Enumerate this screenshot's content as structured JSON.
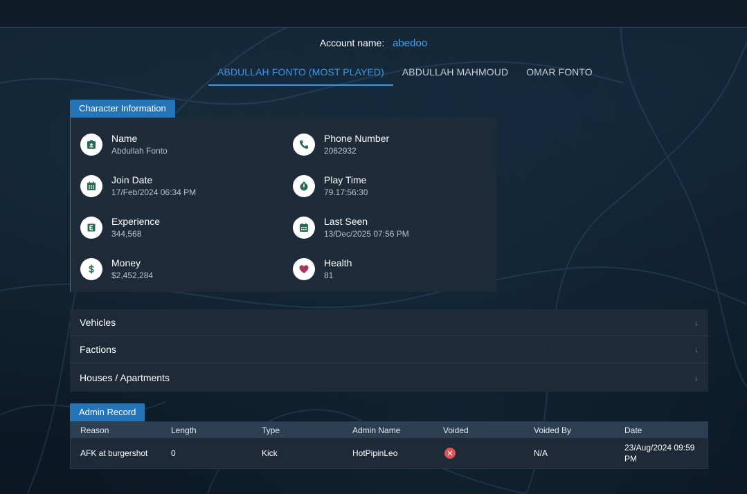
{
  "account": {
    "label": "Account name:",
    "value": "abedoo"
  },
  "tabs": [
    {
      "label": "ABDULLAH FONTO (MOST PLAYED)",
      "active": true
    },
    {
      "label": "ABDULLAH MAHMOUD",
      "active": false
    },
    {
      "label": "OMAR FONTO",
      "active": false
    }
  ],
  "character": {
    "title": "Character Information",
    "stats": [
      {
        "label": "Name",
        "value": "Abdullah Fonto",
        "icon": "id-badge-icon"
      },
      {
        "label": "Phone Number",
        "value": "2062932",
        "icon": "phone-icon"
      },
      {
        "label": "Join Date",
        "value": "17/Feb/2024 06:34 PM",
        "icon": "calendar-icon"
      },
      {
        "label": "Play Time",
        "value": "79.17:56:30",
        "icon": "stopwatch-icon"
      },
      {
        "label": "Experience",
        "value": "344,568",
        "icon": "experience-icon"
      },
      {
        "label": "Last Seen",
        "value": "13/Dec/2025 07:56 PM",
        "icon": "calendar-icon"
      },
      {
        "label": "Money",
        "value": "$2,452,284",
        "icon": "dollar-icon"
      },
      {
        "label": "Health",
        "value": "81",
        "icon": "heart-icon"
      }
    ]
  },
  "sections": [
    {
      "label": "Vehicles"
    },
    {
      "label": "Factions"
    },
    {
      "label": "Houses / Apartments"
    }
  ],
  "admin": {
    "title": "Admin Record",
    "columns": [
      "Reason",
      "Length",
      "Type",
      "Admin Name",
      "Voided",
      "Voided By",
      "Date"
    ],
    "rows": [
      {
        "reason": "AFK at burgershot",
        "length": "0",
        "type": "Kick",
        "admin": "HotPipinLeo",
        "voided": false,
        "voided_by": "N/A",
        "date": "23/Aug/2024 09:59 PM"
      }
    ]
  },
  "colors": {
    "accent": "#3b99e8",
    "badge": "#2574b8",
    "health": "#a63a5e",
    "icon": "#2a6b55",
    "void": "#e05353"
  }
}
